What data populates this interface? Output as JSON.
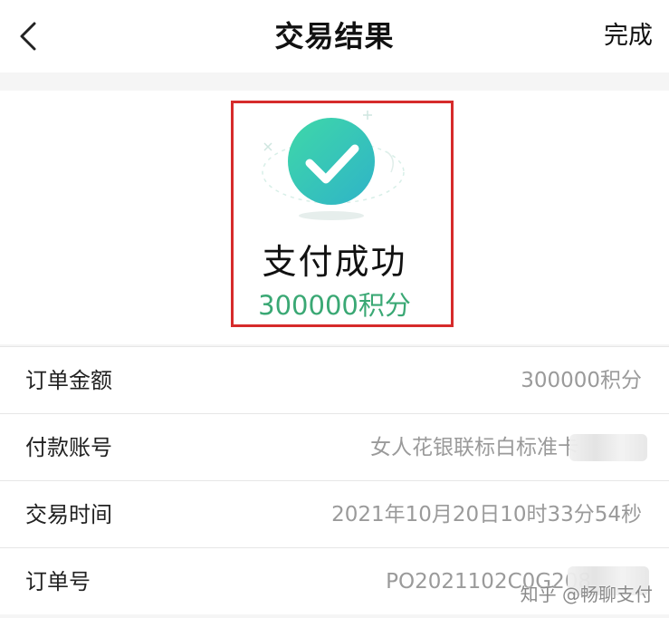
{
  "header": {
    "title": "交易结果",
    "done_label": "完成",
    "back_icon": "chevron-left-icon"
  },
  "result": {
    "status": "支付成功",
    "amount": "300000积分",
    "icon": "check-circle-icon",
    "accent_color": "#3aa874"
  },
  "details": [
    {
      "label": "订单金额",
      "value": "300000积分"
    },
    {
      "label": "付款账号",
      "value": "女人花银联标白标准卡"
    },
    {
      "label": "交易时间",
      "value": "2021年10月20日10时33分54秒"
    },
    {
      "label": "订单号",
      "value": "PO2021102C0G208"
    }
  ],
  "watermark": "知乎 @畅聊支付"
}
